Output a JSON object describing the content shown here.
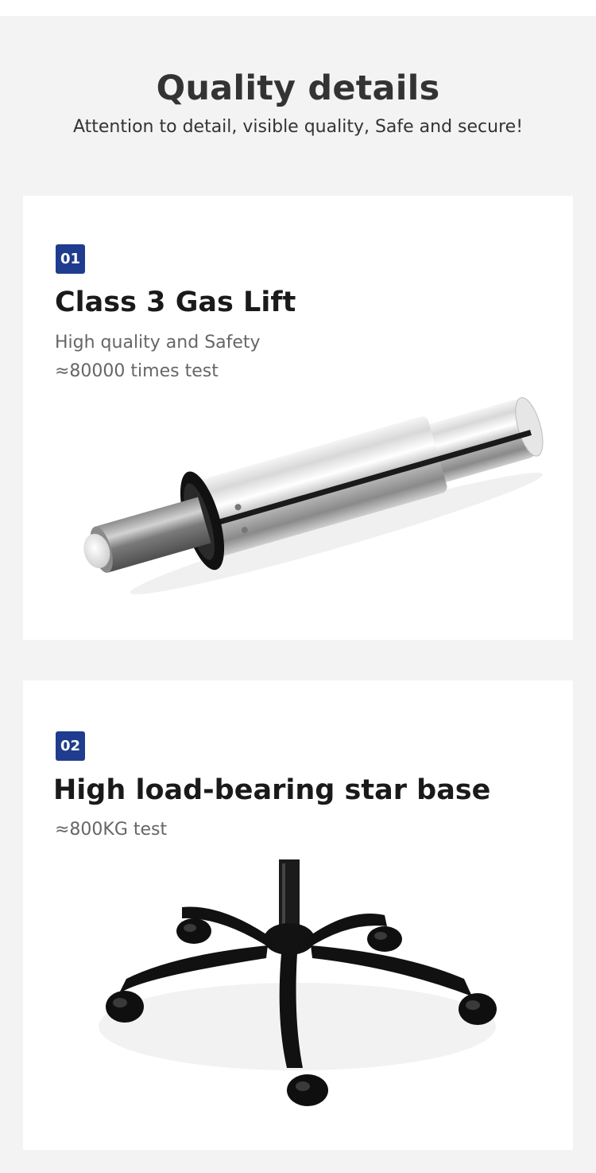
{
  "header": {
    "title": "Quality details",
    "subtitle": "Attention to detail, visible quality, Safe and secure!"
  },
  "features": [
    {
      "number": "01",
      "title": "Class 3 Gas Lift",
      "lines": [
        "High quality and Safety",
        "≈80000 times test"
      ],
      "image_icon": "gas-lift-cylinder"
    },
    {
      "number": "02",
      "title": "High load-bearing star base",
      "lines": [
        "≈800KG test"
      ],
      "image_icon": "star-base-with-casters"
    }
  ],
  "colors": {
    "page_background": "#f3f3f3",
    "card_background": "#ffffff",
    "badge": "#1f3c8e"
  }
}
